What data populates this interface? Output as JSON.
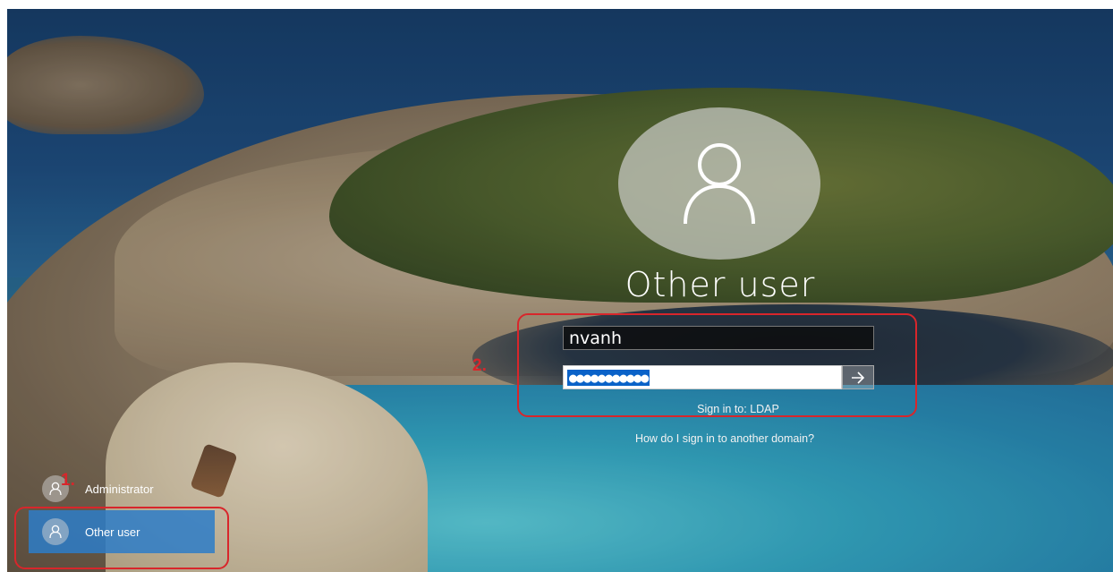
{
  "login": {
    "user_display_name": "Other user",
    "username_value": "nvanh",
    "password_masked": "●●●●●●●●●●●",
    "sign_in_to_text": "Sign in to: LDAP",
    "other_domain_link": "How do I sign in to another domain?"
  },
  "users": [
    {
      "label": "Administrator",
      "selected": false
    },
    {
      "label": "Other user",
      "selected": true
    }
  ],
  "annotations": {
    "step1": "1.",
    "step2": "2.",
    "color": "#d8262b"
  },
  "icons": {
    "avatar": "user-icon",
    "submit": "arrow-right-icon"
  },
  "colors": {
    "selected_tile": "#2d7dc8",
    "password_selection": "#0a62c8"
  }
}
